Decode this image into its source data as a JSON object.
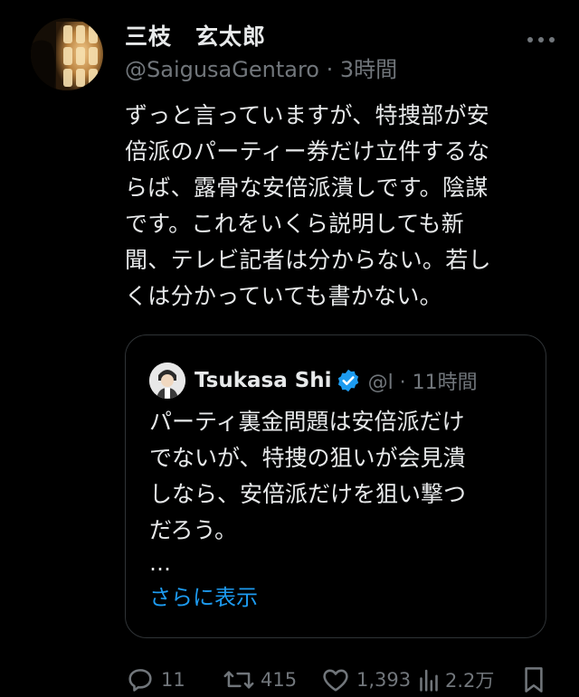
{
  "author": {
    "display_name": "三枝　玄太郎",
    "handle": "@SaigusaGentaro",
    "separator": " · ",
    "time": "3時間"
  },
  "tweet": {
    "text": "ずっと言っていますが、特捜部が安\n倍派のパーティー券だけ立件するな\nらば、露骨な安倍派潰しです。陰謀\nです。これをいくら説明しても新\n聞、テレビ記者は分からない。若し\nくは分かっていても書かない。"
  },
  "quoted": {
    "name": "Tsukasa Shi",
    "handle_fragment": "@l",
    "separator": " · ",
    "time": "11時間",
    "text": "パーティ裏金問題は安倍派だけ\nでないが、特捜の狙いが会見潰\nしなら、安倍派だけを狙い撃つ\nだろう。",
    "ellipsis": "…",
    "show_more": "さらに表示"
  },
  "actions": {
    "replies": "11",
    "reposts": "415",
    "likes": "1,393",
    "views": "2.2万"
  },
  "icons": {
    "more": "more-dots-icon",
    "verified": "verified-badge-icon",
    "reply": "reply-icon",
    "repost": "repost-icon",
    "like": "heart-icon",
    "views": "views-chart-icon",
    "bookmark": "bookmark-icon"
  },
  "colors": {
    "background": "#000000",
    "text": "#e7e9ea",
    "muted": "#71767b",
    "link": "#1d9bf0",
    "border": "#2f3336"
  }
}
